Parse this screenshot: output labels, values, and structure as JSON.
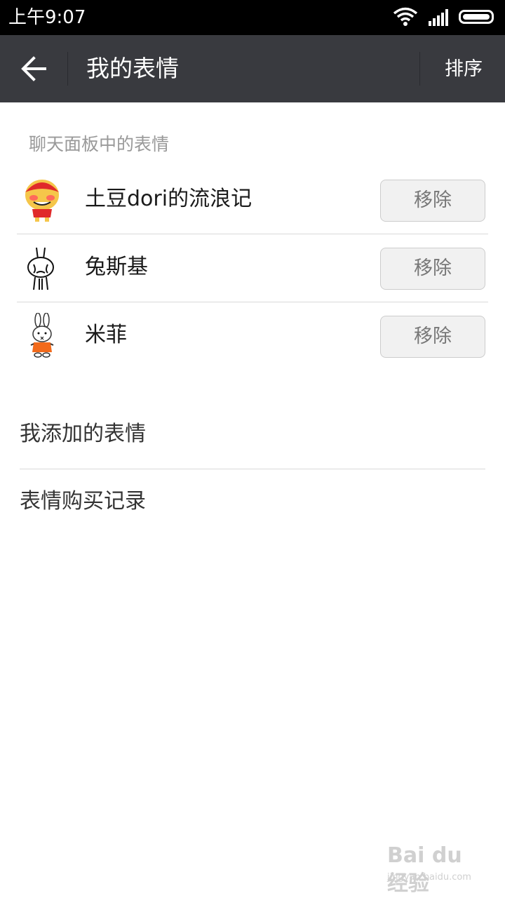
{
  "status_bar": {
    "time": "上午9:07"
  },
  "title_bar": {
    "title": "我的表情",
    "sort_label": "排序"
  },
  "chat_panel": {
    "header": "聊天面板中的表情",
    "items": [
      {
        "name": "土豆dori的流浪记",
        "icon": "potato-dori-sticker-icon",
        "action": "移除"
      },
      {
        "name": "兔斯基",
        "icon": "tuzki-sticker-icon",
        "action": "移除"
      },
      {
        "name": "米菲",
        "icon": "miffy-sticker-icon",
        "action": "移除"
      }
    ]
  },
  "menu": {
    "my_added": "我添加的表情",
    "purchase_history": "表情购买记录"
  },
  "watermark": {
    "logo": "Bai du 经验",
    "url": "jingyan.baidu.com"
  },
  "colors": {
    "status_bar": "#000000",
    "title_bar": "#393a3f",
    "section_header": "#999999",
    "button_bg": "#f1f1f1",
    "divider": "#d9d9d9"
  }
}
